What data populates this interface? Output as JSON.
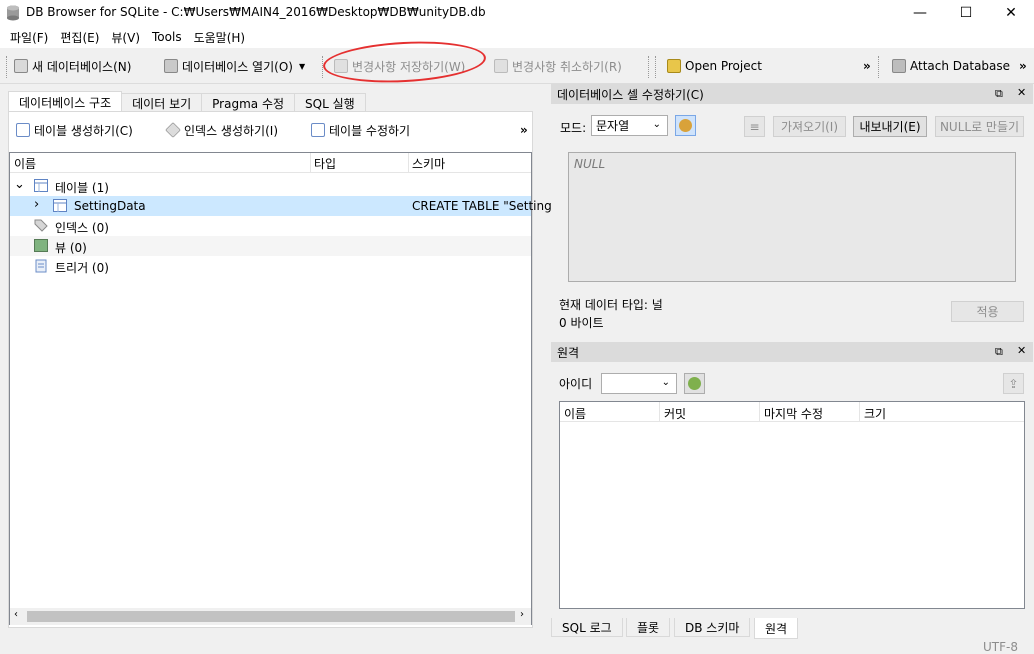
{
  "window": {
    "title": "DB Browser for SQLite - C:₩Users₩MAIN4_2016₩Desktop₩DB₩unityDB.db",
    "minimize": "—",
    "maximize": "☐",
    "close": "✕"
  },
  "menu": [
    "파일(F)",
    "편집(E)",
    "뷰(V)",
    "Tools",
    "도움말(H)"
  ],
  "toolbar": {
    "new_db": "새 데이터베이스(N)",
    "open_db": "데이터베이스 열기(O)",
    "write_changes": "변경사항 저장하기(W)",
    "revert_changes": "변경사항 취소하기(R)",
    "open_project": "Open Project",
    "attach_db": "Attach Database",
    "overflow": "»"
  },
  "main_tabs": [
    "데이터베이스 구조",
    "데이터 보기",
    "Pragma 수정",
    "SQL 실행"
  ],
  "structure_toolbar": {
    "create_table": "테이블 생성하기(C)",
    "create_index": "인덱스 생성하기(I)",
    "modify_table": "테이블 수정하기",
    "overflow": "»"
  },
  "tree": {
    "columns": [
      "이름",
      "타입",
      "스키마"
    ],
    "rows": [
      {
        "name": "테이블 (1)",
        "type": "",
        "schema": "",
        "icon": "table-icon",
        "expand": "⌄"
      },
      {
        "name": "SettingData",
        "type": "",
        "schema": "CREATE TABLE \"Setting",
        "icon": "table-icon",
        "expand": "›"
      },
      {
        "name": "인덱스 (0)",
        "type": "",
        "schema": "",
        "icon": "index-tag-icon",
        "expand": ""
      },
      {
        "name": "뷰 (0)",
        "type": "",
        "schema": "",
        "icon": "view-icon",
        "expand": ""
      },
      {
        "name": "트리거 (0)",
        "type": "",
        "schema": "",
        "icon": "trigger-icon",
        "expand": ""
      }
    ]
  },
  "edit_cell": {
    "title": "데이터베이스 셀 수정하기(C)",
    "mode_label": "모드:",
    "mode_value": "문자열",
    "import_btn": "가져오기(I)",
    "export_btn": "내보내기(E)",
    "null_btn": "NULL로 만들기",
    "cell_text": "NULL",
    "type_text": "현재 데이터 타입: 널",
    "size_text": "0 바이트",
    "apply_btn": "적용"
  },
  "remote": {
    "title": "원격",
    "id_label": "아이디",
    "columns": [
      "이름",
      "커밋",
      "마지막 수정",
      "크기"
    ]
  },
  "bottom_tabs": [
    "SQL 로그",
    "플롯",
    "DB 스키마",
    "원격"
  ],
  "status": {
    "encoding": "UTF-8"
  },
  "colors": {
    "highlight": "#cce8ff",
    "annotation_circle": "#e53030"
  }
}
